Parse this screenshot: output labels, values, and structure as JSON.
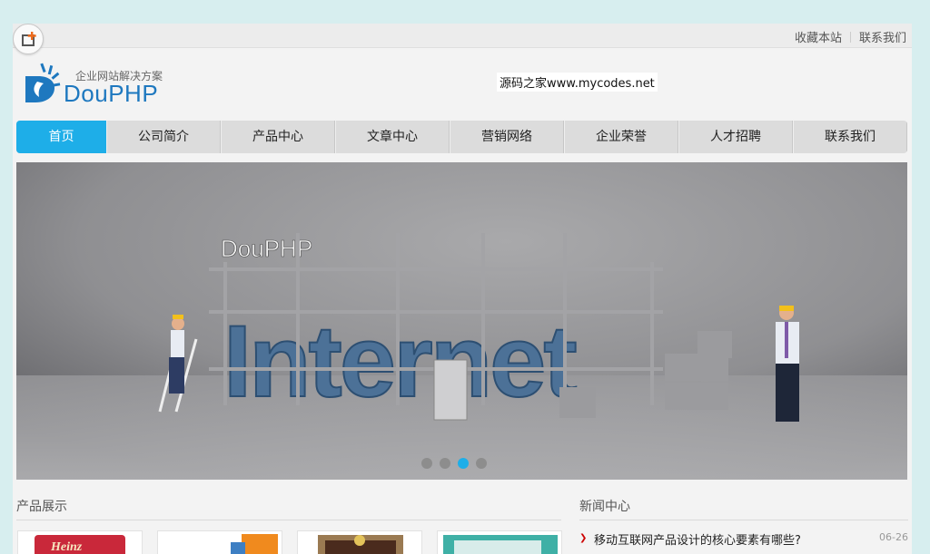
{
  "topbar": {
    "links": [
      "收藏本站",
      "联系我们"
    ]
  },
  "logo": {
    "tagline": "企业网站解决方案",
    "brand": "DouPHP"
  },
  "ad_text": "源码之家www.mycodes.net",
  "nav": {
    "items": [
      "首页",
      "公司简介",
      "产品中心",
      "文章中心",
      "营销网络",
      "企业荣誉",
      "人才招聘",
      "联系我们"
    ],
    "active_index": 0
  },
  "banner": {
    "caption": "DouPHP",
    "word": "Internet",
    "slide_count": 4,
    "active_slide": 3
  },
  "products": {
    "title": "产品展示"
  },
  "news": {
    "title": "新闻中心",
    "items": [
      {
        "title": "移动互联网产品设计的核心要素有哪些?",
        "date": "06-26"
      }
    ]
  },
  "colors": {
    "accent": "#1eaee8",
    "brand_blue": "#1e78bf",
    "background": "#d7eeef"
  }
}
